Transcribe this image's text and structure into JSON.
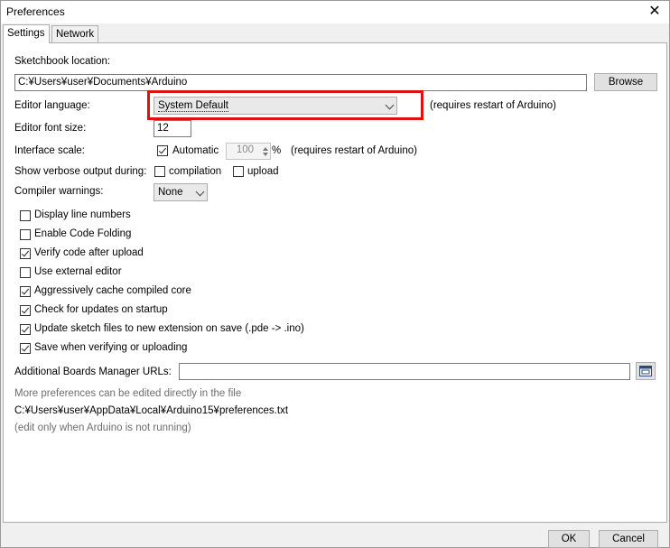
{
  "window": {
    "title": "Preferences"
  },
  "tabs": [
    {
      "label": "Settings"
    },
    {
      "label": "Network"
    }
  ],
  "sketchbook": {
    "label": "Sketchbook location:",
    "value": "C:¥Users¥user¥Documents¥Arduino",
    "browse_label": "Browse"
  },
  "editor_language": {
    "label": "Editor language:",
    "value": "System Default",
    "note": "(requires restart of Arduino)"
  },
  "editor_font": {
    "label": "Editor font size:",
    "value": "12"
  },
  "interface_scale": {
    "label": "Interface scale:",
    "automatic_label": "Automatic",
    "automatic_checked": true,
    "value": "100",
    "unit": "%",
    "note": "(requires restart of Arduino)"
  },
  "verbose": {
    "label": "Show verbose output during:",
    "compilation_label": "compilation",
    "upload_label": "upload"
  },
  "compiler_warnings": {
    "label": "Compiler warnings:",
    "value": "None"
  },
  "options": [
    {
      "label": "Display line numbers",
      "checked": false
    },
    {
      "label": "Enable Code Folding",
      "checked": false
    },
    {
      "label": "Verify code after upload",
      "checked": true
    },
    {
      "label": "Use external editor",
      "checked": false
    },
    {
      "label": "Aggressively cache compiled core",
      "checked": true
    },
    {
      "label": "Check for updates on startup",
      "checked": true
    },
    {
      "label": "Update sketch files to new extension on save (.pde -> .ino)",
      "checked": true
    },
    {
      "label": "Save when verifying or uploading",
      "checked": true
    }
  ],
  "boards_manager": {
    "label": "Additional Boards Manager URLs:",
    "value": ""
  },
  "info": {
    "line1": "More preferences can be edited directly in the file",
    "path": "C:¥Users¥user¥AppData¥Local¥Arduino15¥preferences.txt",
    "line3": "(edit only when Arduino is not running)"
  },
  "footer": {
    "ok_label": "OK",
    "cancel_label": "Cancel"
  },
  "colors": {
    "highlight": "#e01010"
  }
}
